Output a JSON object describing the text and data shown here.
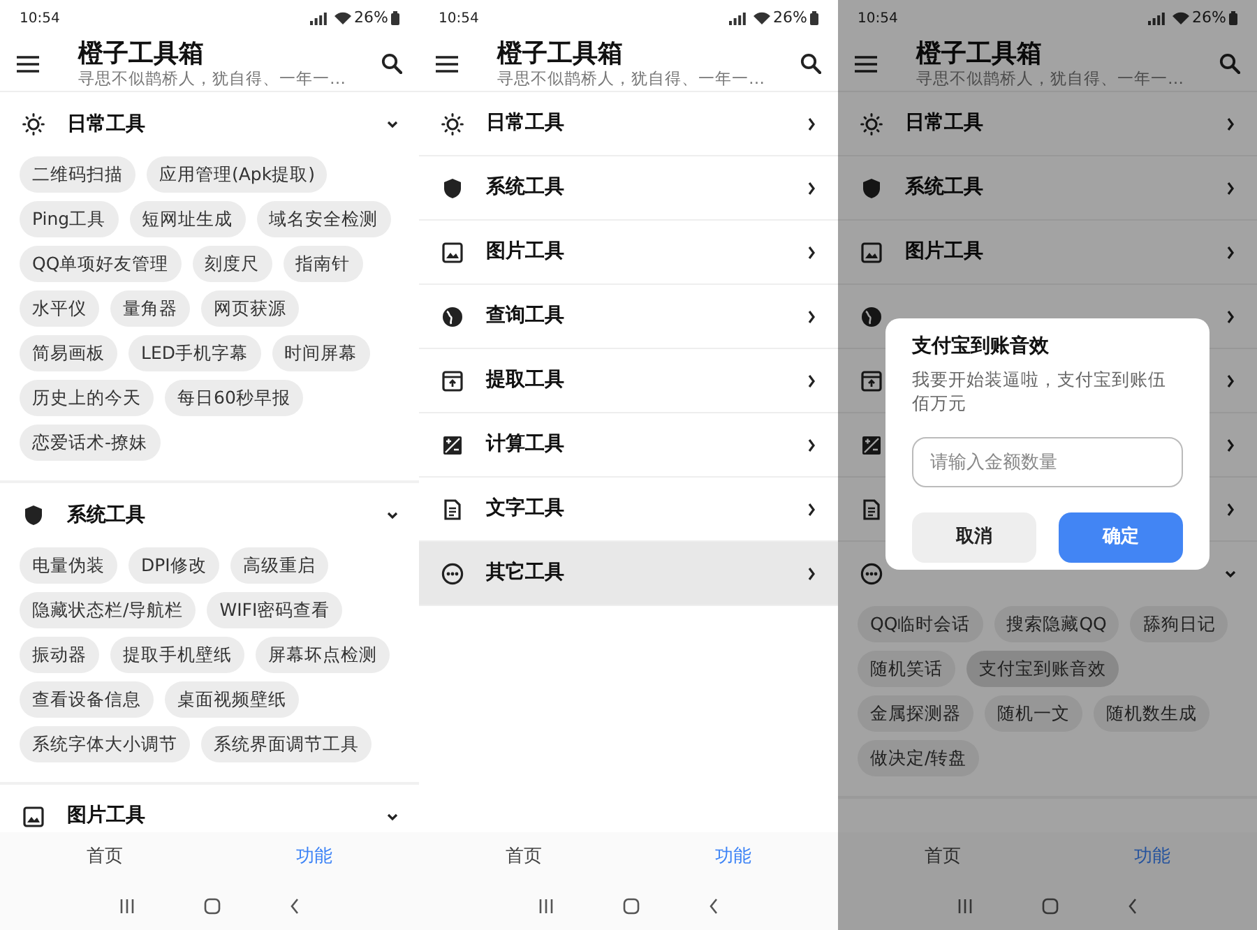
{
  "screens": [
    {
      "status_bar": {
        "time": "10:54",
        "battery": "26%"
      },
      "app_bar": {
        "title": "橙子工具箱",
        "subtitle": "寻思不似鹊桥人，犹自得、一年一…"
      },
      "sections": [
        {
          "label": "日常工具",
          "expanded": true,
          "selected": false,
          "tools": [
            {
              "label": "二维码扫描"
            },
            {
              "label": "应用管理(Apk提取)"
            },
            {
              "label": "Ping工具"
            },
            {
              "label": "短网址生成"
            },
            {
              "label": "域名安全检测"
            },
            {
              "label": "QQ单项好友管理"
            },
            {
              "label": "刻度尺"
            },
            {
              "label": "指南针"
            },
            {
              "label": "水平仪"
            },
            {
              "label": "量角器"
            },
            {
              "label": "网页获源"
            },
            {
              "label": "简易画板"
            },
            {
              "label": "LED手机字幕"
            },
            {
              "label": "时间屏幕"
            },
            {
              "label": "历史上的今天"
            },
            {
              "label": "每日60秒早报"
            },
            {
              "label": "恋爱话术-撩妹"
            }
          ]
        },
        {
          "label": "系统工具",
          "expanded": true,
          "selected": false,
          "tools": [
            {
              "label": "电量伪装"
            },
            {
              "label": "DPI修改"
            },
            {
              "label": "高级重启"
            },
            {
              "label": "隐藏状态栏/导航栏"
            },
            {
              "label": "WIFI密码查看"
            },
            {
              "label": "振动器"
            },
            {
              "label": "提取手机壁纸"
            },
            {
              "label": "屏幕坏点检测"
            },
            {
              "label": "查看设备信息"
            },
            {
              "label": "桌面视频壁纸"
            },
            {
              "label": "系统字体大小调节"
            },
            {
              "label": "系统界面调节工具"
            }
          ]
        },
        {
          "label": "图片工具",
          "expanded": true,
          "selected": false
        }
      ],
      "bottom_nav": [
        {
          "label": "首页",
          "selected": false
        },
        {
          "label": "功能",
          "selected": true
        }
      ]
    },
    {
      "status_bar": {
        "time": "10:54",
        "battery": "26%"
      },
      "app_bar": {
        "title": "橙子工具箱",
        "subtitle": "寻思不似鹊桥人，犹自得、一年一…"
      },
      "sections": [
        {
          "label": "日常工具",
          "expanded": false,
          "selected": false
        },
        {
          "label": "系统工具",
          "expanded": false,
          "selected": false
        },
        {
          "label": "图片工具",
          "expanded": false,
          "selected": false
        },
        {
          "label": "查询工具",
          "expanded": false,
          "selected": false
        },
        {
          "label": "提取工具",
          "expanded": false,
          "selected": false
        },
        {
          "label": "计算工具",
          "expanded": false,
          "selected": false
        },
        {
          "label": "文字工具",
          "expanded": false,
          "selected": false
        },
        {
          "label": "其它工具",
          "expanded": false,
          "selected": true
        }
      ],
      "bottom_nav": [
        {
          "label": "首页",
          "selected": false
        },
        {
          "label": "功能",
          "selected": true
        }
      ]
    },
    {
      "status_bar": {
        "time": "10:54",
        "battery": "26%"
      },
      "app_bar": {
        "title": "橙子工具箱",
        "subtitle": "寻思不似鹊桥人，犹自得、一年一…"
      },
      "sections": [
        {
          "label": "日常工具",
          "expanded": false,
          "selected": false
        },
        {
          "label": "系统工具",
          "expanded": false,
          "selected": false
        },
        {
          "label": "图片工具",
          "expanded": false,
          "selected": false
        },
        {
          "expanded": false,
          "selected": false
        },
        {
          "expanded": false,
          "selected": false
        },
        {
          "expanded": false,
          "selected": false
        },
        {
          "expanded": false,
          "selected": false
        },
        {
          "expanded": true,
          "selected": false,
          "tools": [
            {
              "label": "QQ临时会话",
              "selected": false
            },
            {
              "label": "搜索隐藏QQ",
              "selected": false
            },
            {
              "label": "舔狗日记",
              "selected": false
            },
            {
              "label": "随机笑话",
              "selected": false
            },
            {
              "label": "支付宝到账音效",
              "selected": true
            },
            {
              "label": "金属探测器",
              "selected": false
            },
            {
              "label": "随机一文",
              "selected": false
            },
            {
              "label": "随机数生成",
              "selected": false
            },
            {
              "label": "做决定/转盘",
              "selected": false
            }
          ]
        }
      ],
      "bottom_nav": [
        {
          "label": "首页",
          "selected": false
        },
        {
          "label": "功能",
          "selected": true
        }
      ],
      "dialog": {
        "title": "支付宝到账音效",
        "message": "我要开始装逼啦，支付宝到账伍佰万元",
        "input": {
          "placeholder": "请输入金额数量"
        },
        "buttons": [
          {
            "label": "取消",
            "kind": "cancel"
          },
          {
            "label": "确定",
            "kind": "confirm"
          }
        ]
      }
    }
  ]
}
